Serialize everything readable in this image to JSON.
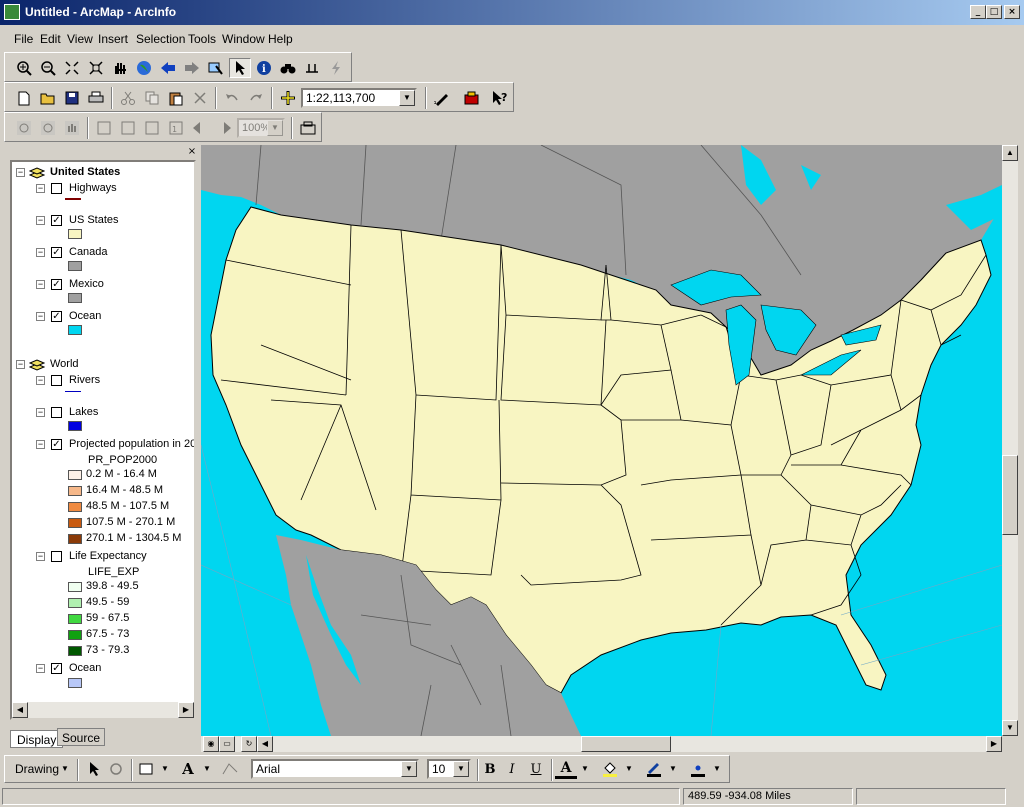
{
  "window": {
    "title": "Untitled - ArcMap - ArcInfo",
    "min": "_",
    "max": "□",
    "close": "×"
  },
  "menu": [
    "File",
    "Edit",
    "View",
    "Insert",
    "Selection",
    "Tools",
    "Window",
    "Help"
  ],
  "scale": {
    "value": "1:22,113,700"
  },
  "zoom": {
    "value": "100%"
  },
  "toc": {
    "groups": [
      {
        "label": "United States",
        "layers": [
          {
            "label": "Highways",
            "checked": false,
            "symbol": "line",
            "color": "#800000"
          },
          {
            "label": "US States",
            "checked": true,
            "symbol": "fill",
            "color": "#f8f5c2"
          },
          {
            "label": "Canada",
            "checked": true,
            "symbol": "fill",
            "color": "#a0a0a0"
          },
          {
            "label": "Mexico",
            "checked": true,
            "symbol": "fill",
            "color": "#a0a0a0"
          },
          {
            "label": "Ocean",
            "checked": true,
            "symbol": "fill",
            "color": "#00d6f0"
          }
        ]
      },
      {
        "label": "World",
        "layers": [
          {
            "label": "Rivers",
            "checked": false,
            "symbol": "line",
            "color": "#0000c0"
          },
          {
            "label": "Lakes",
            "checked": false,
            "symbol": "fill",
            "color": "#0000e0"
          },
          {
            "label": "Projected population in 20",
            "checked": true,
            "field": "PR_POP2000",
            "classes": [
              {
                "label": "0.2 M - 16.4 M",
                "color": "#fdf0e6"
              },
              {
                "label": "16.4 M - 48.5 M",
                "color": "#f6b88a"
              },
              {
                "label": "48.5 M - 107.5 M",
                "color": "#ef8b42"
              },
              {
                "label": "107.5 M - 270.1 M",
                "color": "#c85a10"
              },
              {
                "label": "270.1 M - 1304.5 M",
                "color": "#8a3a08"
              }
            ]
          },
          {
            "label": "Life Expectancy",
            "checked": false,
            "field": "LIFE_EXP",
            "classes": [
              {
                "label": "39.8 - 49.5",
                "color": "#f0fff0"
              },
              {
                "label": "49.5 - 59",
                "color": "#b0f0b0"
              },
              {
                "label": "59 - 67.5",
                "color": "#40d840"
              },
              {
                "label": "67.5 - 73",
                "color": "#10a010"
              },
              {
                "label": "73 - 79.3",
                "color": "#005800"
              }
            ]
          },
          {
            "label": "Ocean",
            "checked": true,
            "symbol": "fill",
            "color": "#b8c8f8"
          }
        ]
      }
    ],
    "tabs": {
      "display": "Display",
      "source": "Source"
    }
  },
  "drawing": {
    "label": "Drawing",
    "font": "Arial",
    "size": "10",
    "bold": "B",
    "italic": "I",
    "underline": "U",
    "fontcolor": "A"
  },
  "status": {
    "coords": "489.59  -934.08 Miles"
  },
  "colors": {
    "ocean": "#00d6f0",
    "states": "#f8f5c2",
    "foreign": "#a0a0a0"
  }
}
